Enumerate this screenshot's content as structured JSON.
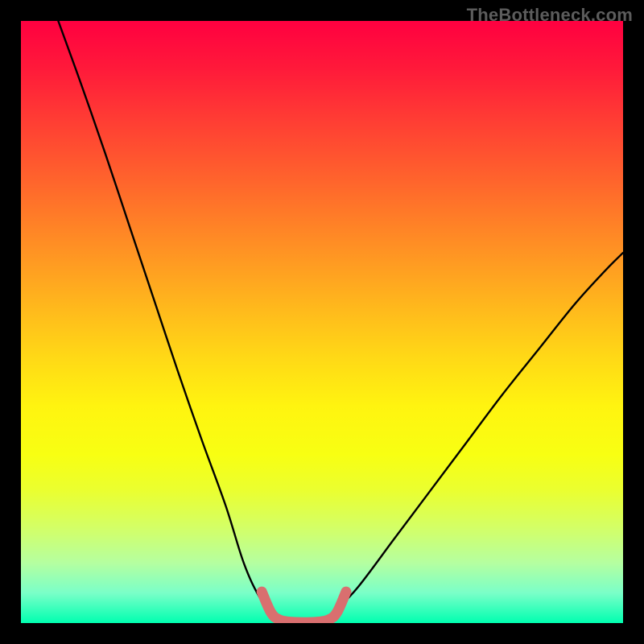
{
  "watermark": "TheBottleneck.com",
  "chart_data": {
    "type": "line",
    "title": "",
    "xlabel": "",
    "ylabel": "",
    "xlim": [
      0,
      100
    ],
    "ylim": [
      0,
      100
    ],
    "series": [
      {
        "name": "left-curve",
        "x": [
          6.2,
          10,
          14,
          18,
          22,
          26,
          30,
          34,
          37,
          39.5,
          41.5
        ],
        "y": [
          100,
          89.5,
          78,
          66,
          54,
          42,
          30.5,
          19.5,
          10,
          4.5,
          1.8
        ],
        "color": "#000000"
      },
      {
        "name": "right-curve",
        "x": [
          52,
          56,
          62,
          68,
          74,
          80,
          86,
          92,
          97,
          100
        ],
        "y": [
          1.8,
          6,
          14,
          22,
          30,
          38,
          45.5,
          53,
          58.5,
          61.5
        ],
        "color": "#000000"
      },
      {
        "name": "valley-highlight",
        "x": [
          40,
          41.5,
          42.8,
          44.5,
          47,
          49.5,
          51.2,
          52.5,
          54
        ],
        "y": [
          5.2,
          1.8,
          0.6,
          0.2,
          0.1,
          0.2,
          0.6,
          1.8,
          5.2
        ],
        "color": "#d96f6f"
      }
    ],
    "background_gradient": {
      "type": "vertical",
      "stops": [
        {
          "pos": 0,
          "color": "#ff0040"
        },
        {
          "pos": 50,
          "color": "#ffd916"
        },
        {
          "pos": 100,
          "color": "#00ffb0"
        }
      ]
    }
  }
}
